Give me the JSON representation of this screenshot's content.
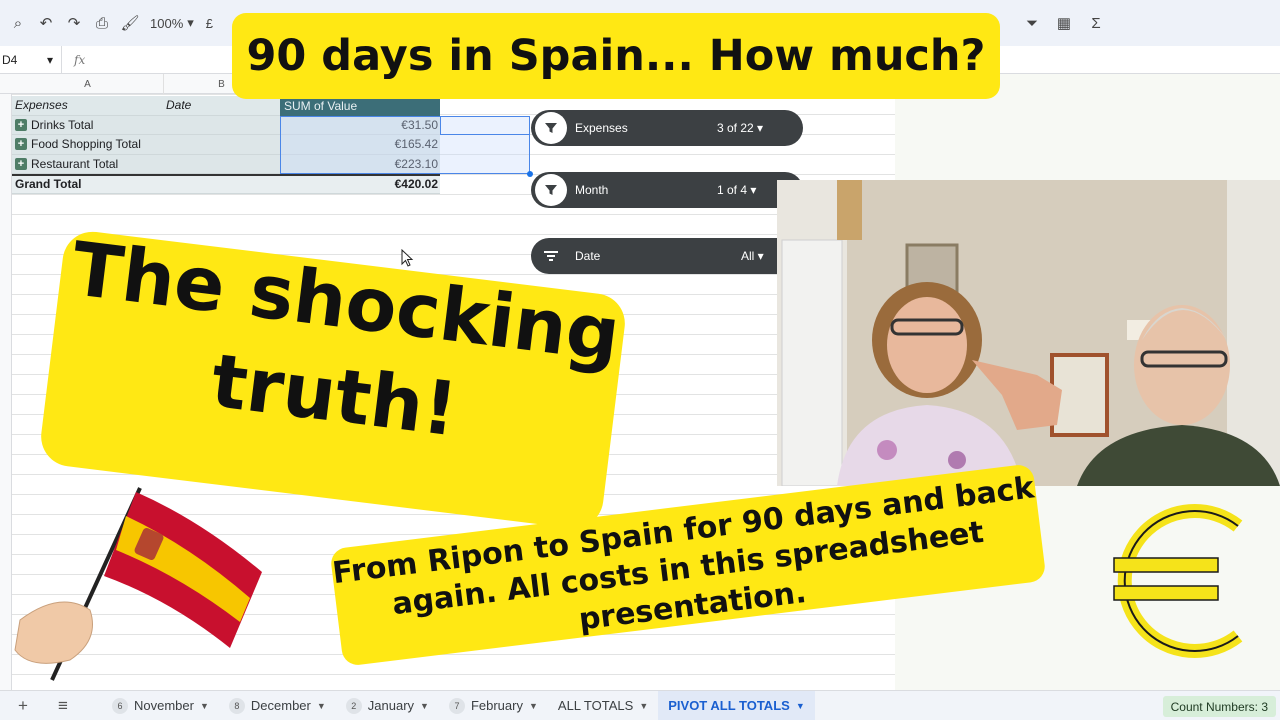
{
  "toolbar": {
    "zoom": "100%",
    "currency_symbol": "£",
    "sigma": "Σ"
  },
  "formula_bar": {
    "cell_ref": "D4",
    "fx": "fx"
  },
  "columns": [
    "A",
    "B"
  ],
  "pivot": {
    "header_expenses": "Expenses",
    "header_date": "Date",
    "header_sum": "SUM of Value",
    "rows": [
      {
        "label": "Drinks Total",
        "value": "€31.50"
      },
      {
        "label": "Food Shopping Total",
        "value": "€165.42"
      },
      {
        "label": "Restaurant Total",
        "value": "€223.10"
      }
    ],
    "grand_total_label": "Grand Total",
    "grand_total_value": "€420.02"
  },
  "slicers": [
    {
      "label": "Expenses",
      "value": "3 of 22"
    },
    {
      "label": "Month",
      "value": "1 of 4"
    },
    {
      "label": "Date",
      "value": "All"
    }
  ],
  "overlay": {
    "headline": "90 days in Spain... How much?",
    "shock_line1": "The shocking",
    "shock_line2": "truth!",
    "caption_line1": "From Ripon to Spain for 90 days and back",
    "caption_line2": "again. All costs in this spreadsheet",
    "caption_line3": "presentation."
  },
  "sheet_tabs": [
    {
      "num": "6",
      "label": "November"
    },
    {
      "num": "8",
      "label": "December"
    },
    {
      "num": "2",
      "label": "January"
    },
    {
      "num": "7",
      "label": "February"
    },
    {
      "num": "",
      "label": "ALL TOTALS"
    },
    {
      "num": "",
      "label": "PIVOT ALL TOTALS"
    }
  ],
  "status": {
    "count": "Count Numbers: 3"
  },
  "colors": {
    "highlight_yellow": "#ffe814",
    "pivot_header": "#3c6e78",
    "slicer": "#3c4043",
    "active_tab": "#1a5fd0"
  }
}
